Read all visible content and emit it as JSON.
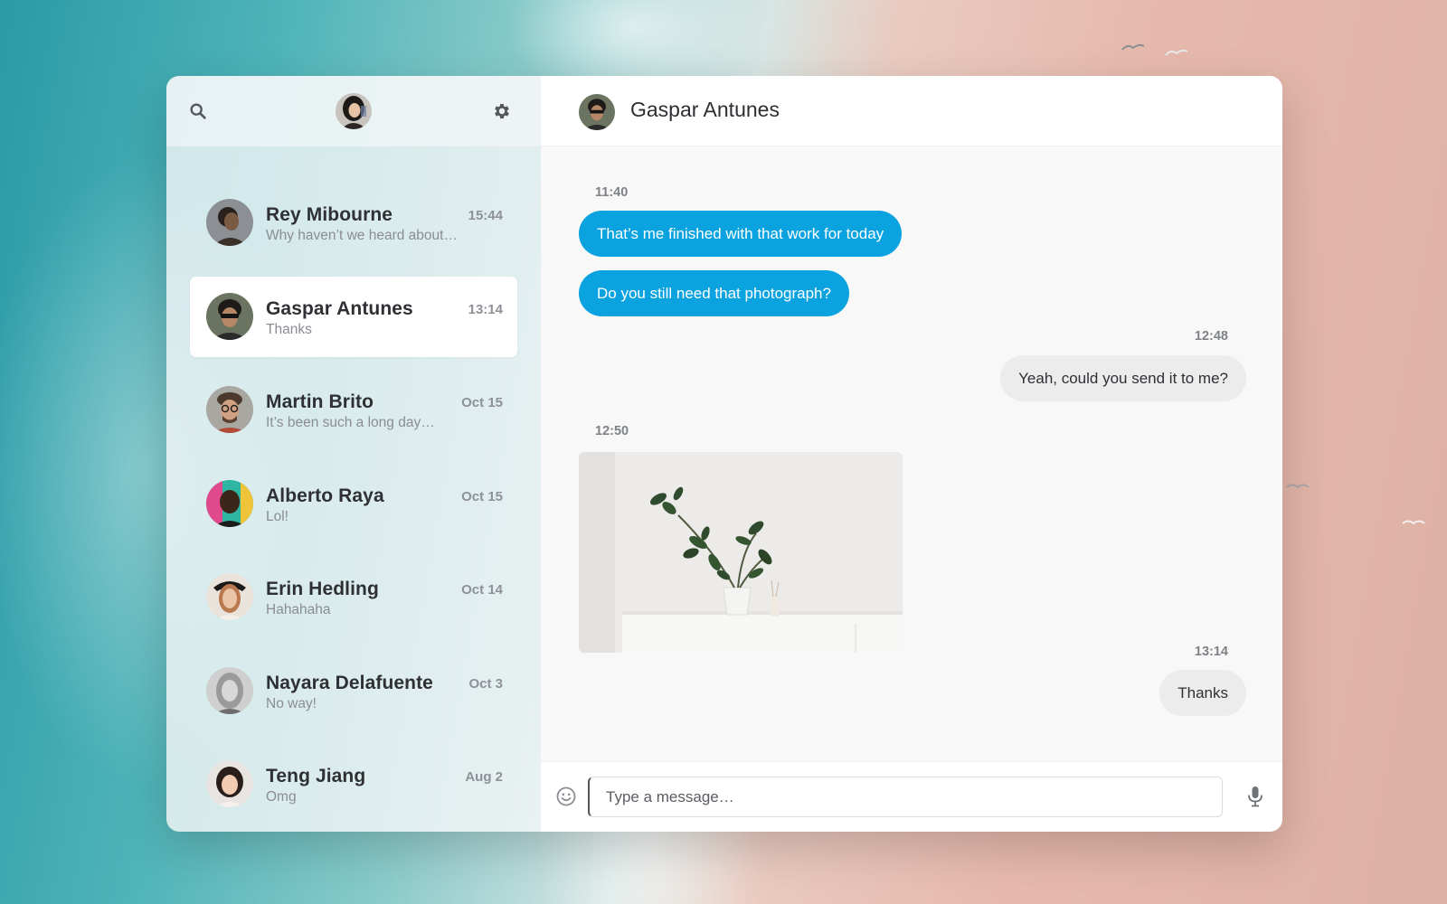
{
  "app": {
    "accent": "#0aa2df"
  },
  "sidebar": {
    "search_icon": "search-icon",
    "settings_icon": "gear-icon",
    "conversations": [
      {
        "name": "Rey Mibourne",
        "preview": "Why haven’t we heard about…",
        "time": "15:44",
        "active": false
      },
      {
        "name": "Gaspar Antunes",
        "preview": "Thanks",
        "time": "13:14",
        "active": true
      },
      {
        "name": "Martin Brito",
        "preview": "It’s been such a long day…",
        "time": "Oct 15",
        "active": false
      },
      {
        "name": "Alberto Raya",
        "preview": "Lol!",
        "time": "Oct 15",
        "active": false
      },
      {
        "name": "Erin Hedling",
        "preview": "Hahahaha",
        "time": "Oct 14",
        "active": false
      },
      {
        "name": "Nayara Delafuente",
        "preview": "No way!",
        "time": "Oct 3",
        "active": false
      },
      {
        "name": "Teng Jiang",
        "preview": "Omg",
        "time": "Aug 2",
        "active": false
      }
    ]
  },
  "chat": {
    "contact_name": "Gaspar Antunes",
    "messages": [
      {
        "time": "11:40"
      },
      {
        "text": "That’s me finished with that work for today",
        "direction": "in"
      },
      {
        "text": "Do you still need that photograph?",
        "direction": "in"
      },
      {
        "time": "12:48"
      },
      {
        "text": "Yeah, could you send it to me?",
        "direction": "out"
      },
      {
        "time": "12:50"
      },
      {
        "image": "photo-plant",
        "direction": "in"
      },
      {
        "time": "13:14"
      },
      {
        "text": "Thanks",
        "direction": "out"
      }
    ]
  },
  "composer": {
    "placeholder": "Type a message…",
    "emoji_icon": "smiley-icon",
    "mic_icon": "microphone-icon"
  }
}
